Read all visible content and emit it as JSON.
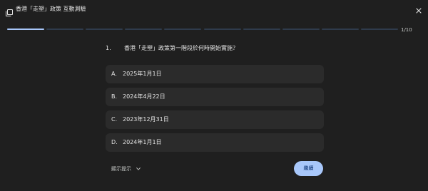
{
  "header": {
    "title": "香港「走塑」政策 互動測驗",
    "icon": "quiz-cards-icon",
    "close_icon": "close-icon"
  },
  "progress": {
    "label": "1/10",
    "current": 1,
    "total": 10
  },
  "question": {
    "number": "1.",
    "text": "香港「走塑」政策第一階段於何時開始實施？"
  },
  "options": [
    {
      "letter": "A.",
      "text": "2025年1月1日"
    },
    {
      "letter": "B.",
      "text": "2024年4月22日"
    },
    {
      "letter": "C.",
      "text": "2023年12月31日"
    },
    {
      "letter": "D.",
      "text": "2024年1月1日"
    }
  ],
  "footer": {
    "hint_label": "顯示提示",
    "continue_label": "繼續"
  },
  "colors": {
    "background": "#1f1f1f",
    "option_bg": "#2b2b2b",
    "accent": "#a8c7fa",
    "progress_inactive": "#2f3b4c"
  }
}
